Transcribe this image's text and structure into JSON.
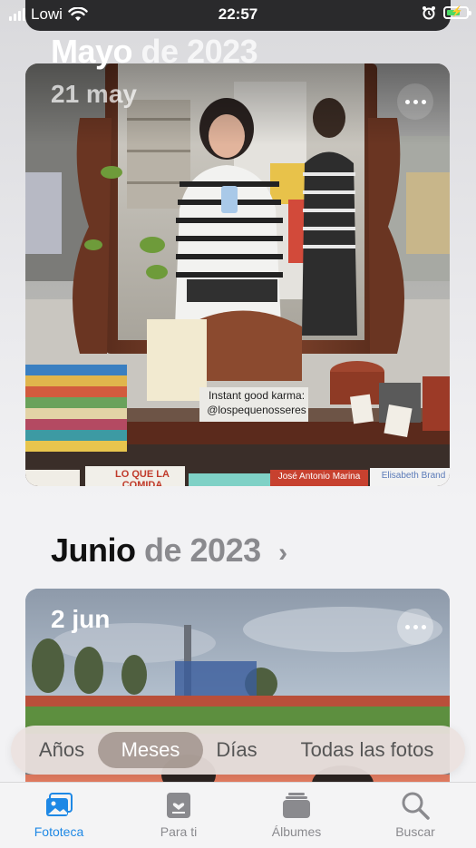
{
  "status_bar": {
    "carrier": "Lowi",
    "time": "22:57"
  },
  "months": [
    {
      "month": "Mayo",
      "year_text": "de 2023",
      "day_label": "21 may",
      "photo": {
        "sign_text_1": "Instant good karma:",
        "sign_text_2": "@lospequenosseres",
        "book_1": "LO QUE LA COMIDA",
        "book_2": "José Antonio Marina",
        "book_3": "Elisabeth Brand"
      }
    },
    {
      "month": "Junio",
      "year_text": "de 2023",
      "day_label": "2 jun"
    }
  ],
  "view_selector": {
    "options": [
      "Años",
      "Meses",
      "Días",
      "Todas las fotos"
    ],
    "selected": "Meses"
  },
  "tab_bar": {
    "items": [
      {
        "label": "Fototeca",
        "icon": "photos-library-icon",
        "active": true
      },
      {
        "label": "Para ti",
        "icon": "for-you-icon",
        "active": false
      },
      {
        "label": "Álbumes",
        "icon": "albums-icon",
        "active": false
      },
      {
        "label": "Buscar",
        "icon": "search-icon",
        "active": false
      }
    ]
  },
  "colors": {
    "accent": "#1e88e5",
    "inactive": "#8a8a8e",
    "title_dark": "#111111"
  }
}
